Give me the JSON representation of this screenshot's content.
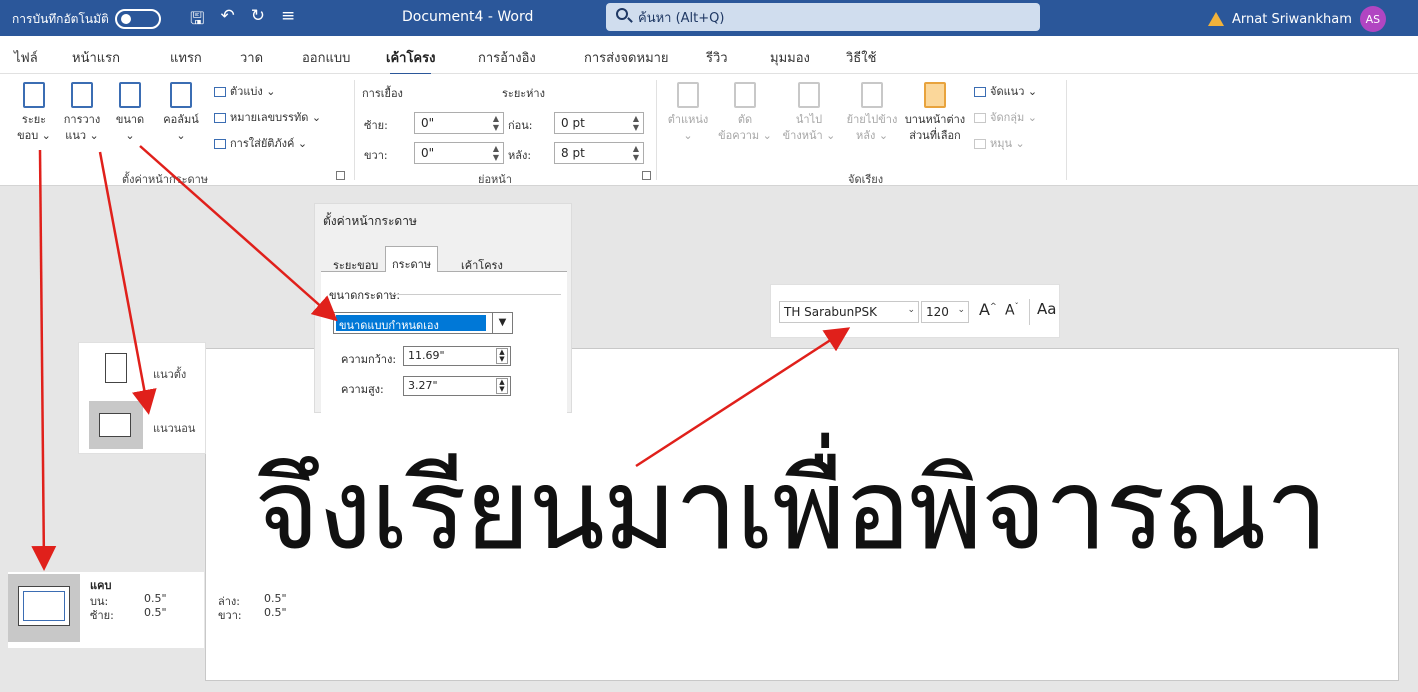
{
  "titlebar": {
    "autosave_label": "การบันทึกอัตโนมัติ",
    "doc_title": "Document4  -  Word",
    "search_placeholder": "ค้นหา (Alt+Q)",
    "user_name": "Arnat Sriwankham",
    "user_initials": "AS"
  },
  "tabs": [
    "ไฟล์",
    "หน้าแรก",
    "แทรก",
    "วาด",
    "ออกแบบ",
    "เค้าโครง",
    "การอ้างอิง",
    "การส่งจดหมาย",
    "รีวิว",
    "มุมมอง",
    "วิธีใช้"
  ],
  "active_tab": "เค้าโครง",
  "ribbon": {
    "margins": [
      "ระยะ",
      "ขอบ ⌄"
    ],
    "orientation": [
      "การวาง",
      "แนว ⌄"
    ],
    "size": [
      "ขนาด",
      "⌄"
    ],
    "columns": [
      "คอลัมน์",
      "⌄"
    ],
    "breaks": "ตัวแบ่ง ⌄",
    "line_numbers": "หมายเลขบรรทัด ⌄",
    "hyphenation": "การใส่ยัติภังค์ ⌄",
    "group_page_setup": "ตั้งค่าหน้ากระดาษ",
    "indent_label": "การเยื้อง",
    "spacing_label": "ระยะห่าง",
    "indent_left_label": "ซ้าย:",
    "indent_left": "0\"",
    "indent_right_label": "ขวา:",
    "indent_right": "0\"",
    "spacing_before_label": "ก่อน:",
    "spacing_before": "0 pt",
    "spacing_after_label": "หลัง:",
    "spacing_after": "8 pt",
    "group_paragraph": "ย่อหน้า",
    "position": [
      "ตำแหน่ง",
      "⌄"
    ],
    "wrap_text": [
      "ตัด",
      "ข้อความ ⌄"
    ],
    "bring_forward": [
      "นำไป",
      "ข้างหน้า ⌄"
    ],
    "send_backward": [
      "ย้ายไปข้าง",
      "หลัง ⌄"
    ],
    "selection_pane": [
      "บานหน้าต่าง",
      "ส่วนที่เลือก"
    ],
    "align": "จัดแนว ⌄",
    "group_btn": "จัดกลุ่ม ⌄",
    "rotate": "หมุน ⌄",
    "group_arrange": "จัดเรียง"
  },
  "dialog": {
    "title": "ตั้งค่าหน้ากระดาษ",
    "tabs": [
      "ระยะขอบ",
      "กระดาษ",
      "เค้าโครง"
    ],
    "active_tab": "กระดาษ",
    "paper_size_label": "ขนาดกระดาษ:",
    "paper_size_value": "ขนาดแบบกำหนดเอง",
    "width_label": "ความกว้าง:",
    "width_value": "11.69\"",
    "height_label": "ความสูง:",
    "height_value": "3.27\""
  },
  "fontbar": {
    "font_name": "TH SarabunPSK",
    "font_size": "120",
    "grow": "A",
    "shrink": "A",
    "case": "Aa"
  },
  "orientation_popup": {
    "portrait": "แนวตั้ง",
    "landscape": "แนวนอน"
  },
  "margins_popup": {
    "name": "แคบ",
    "top_label": "บน:",
    "top": "0.5\"",
    "bottom_label": "ล่าง:",
    "bottom": "0.5\"",
    "left_label": "ซ้าย:",
    "left": "0.5\"",
    "right_label": "ขวา:",
    "right": "0.5\""
  },
  "document_text": "จึงเรียนมาเพื่อพิจารณา",
  "colors": {
    "titlebar": "#2b579a",
    "arrow": "#e0201b",
    "avatar": "#b146c2"
  }
}
